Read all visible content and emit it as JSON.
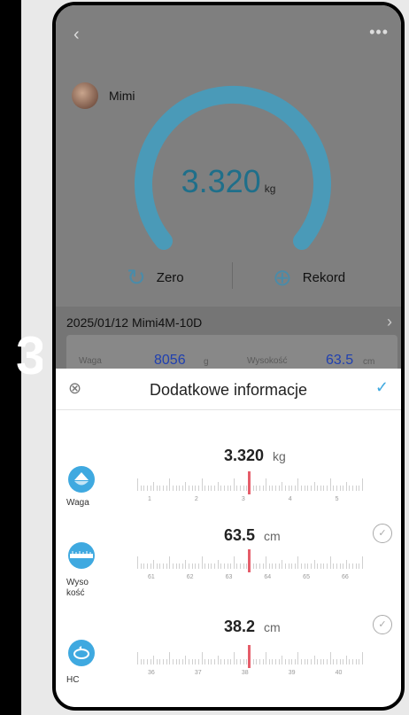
{
  "step_number": "3",
  "header": {
    "back_icon": "chevron-left-icon",
    "more_icon": "more-icon"
  },
  "user": {
    "name": "Mimi"
  },
  "gauge": {
    "weight": "3.320",
    "unit": "kg"
  },
  "controls": {
    "zero_label": "Zero",
    "rekord_label": "Rekord"
  },
  "record": {
    "date_device": "2025/01/12   Mimi4M-10D",
    "weight_label": "Waga",
    "weight_value": "8056",
    "weight_unit": "g",
    "height_label": "Wysokość",
    "height_value": "63.5",
    "height_unit": "cm"
  },
  "sheet": {
    "title": "Dodatkowe informacje",
    "measurements": [
      {
        "label": "Waga",
        "value": "3.320",
        "unit": "kg",
        "ticks": [
          "1",
          "2",
          "3",
          "4",
          "5"
        ]
      },
      {
        "label_line1": "Wyso",
        "label_line2": "kość",
        "value": "63.5",
        "unit": "cm",
        "ticks": [
          "61",
          "62",
          "63",
          "64",
          "65",
          "66"
        ]
      },
      {
        "label": "HC",
        "value": "38.2",
        "unit": "cm",
        "ticks": [
          "36",
          "37",
          "38",
          "39",
          "40"
        ]
      }
    ]
  },
  "colors": {
    "accent": "#3fa9e0",
    "gauge": "#4a9ab8",
    "pointer": "#e55d6a",
    "record_value": "#2040b0"
  }
}
